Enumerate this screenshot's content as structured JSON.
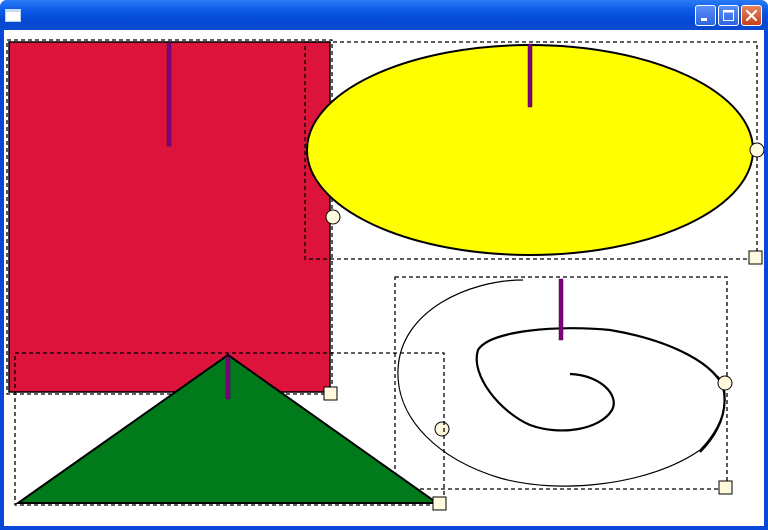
{
  "window": {
    "title": "",
    "controls": {
      "minimize": "minimize",
      "maximize": "maximize",
      "close": "close"
    }
  },
  "shapes": [
    {
      "name": "red-rectangle",
      "kind": "rectangle",
      "fill": "#dc143c"
    },
    {
      "name": "yellow-ellipse",
      "kind": "ellipse",
      "fill": "#ffff00"
    },
    {
      "name": "spiral-path",
      "kind": "freehand",
      "fill": "none"
    },
    {
      "name": "green-triangle",
      "kind": "triangle",
      "fill": "#007a1a"
    }
  ],
  "colors": {
    "selection_border": "#000000",
    "rotation_handle": "#800080",
    "handle_fill": "#fffadc"
  }
}
